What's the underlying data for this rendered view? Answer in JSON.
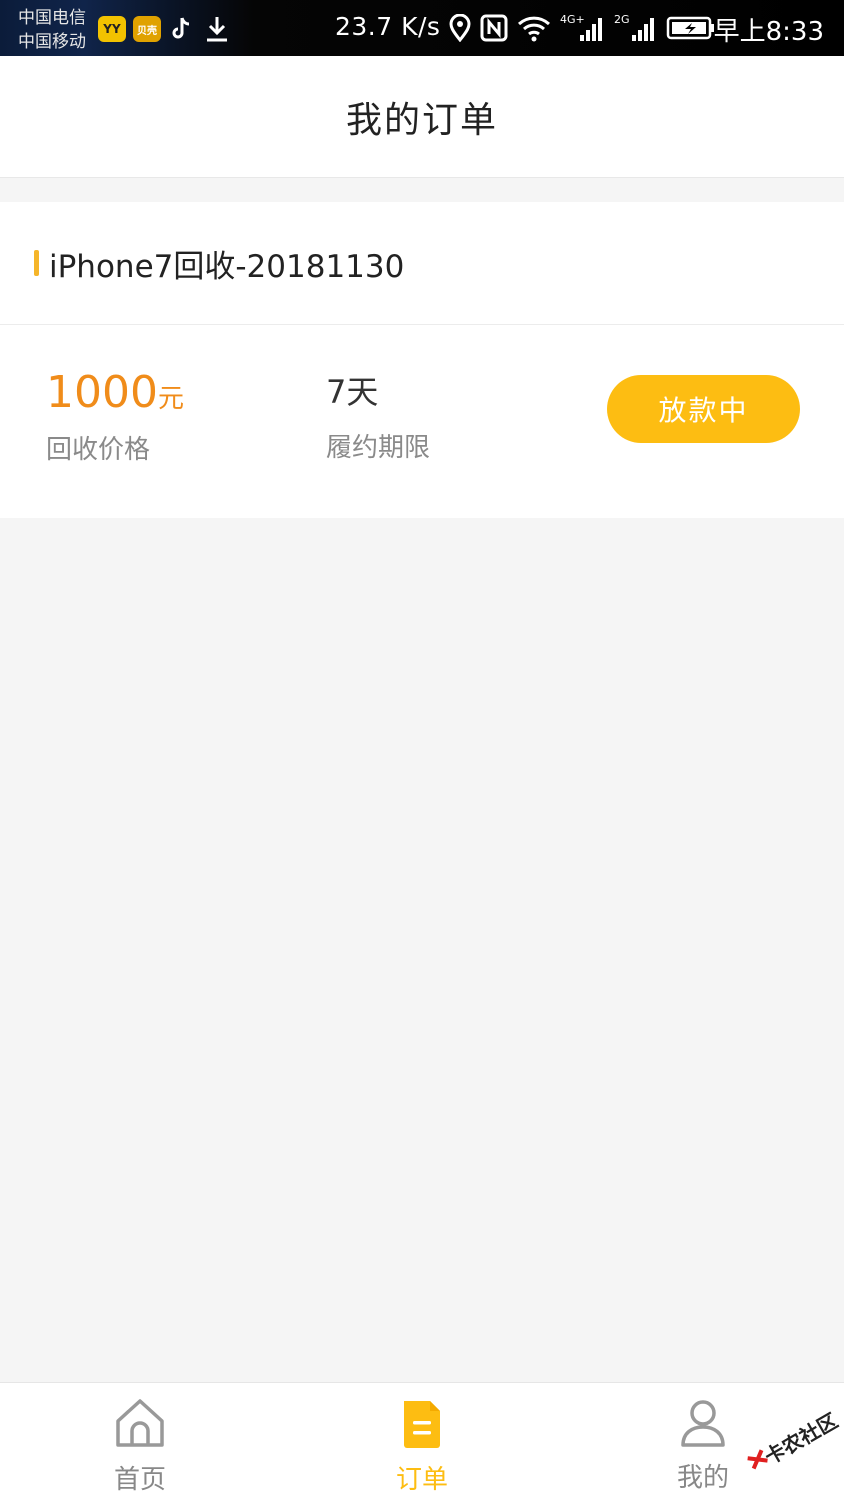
{
  "status_bar": {
    "carrier_1": "中国电信",
    "carrier_2": "中国移动",
    "app_yy": "YY",
    "app_bb": "贝壳",
    "net_speed": "23.7 K/s",
    "clock": "早上8:33",
    "icons": [
      "location-icon",
      "nfc-icon",
      "wifi-icon",
      "signal-4g-icon",
      "signal-2g-icon",
      "battery-charging-icon"
    ]
  },
  "header": {
    "title": "我的订单"
  },
  "order": {
    "title": "iPhone7回收-20181130",
    "price_value": "1000",
    "price_unit": "元",
    "price_label": "回收价格",
    "term_value": "7天",
    "term_label": "履约期限",
    "status_button": "放款中"
  },
  "nav": {
    "items": [
      {
        "label": "首页",
        "icon": "home-icon"
      },
      {
        "label": "订单",
        "icon": "document-icon",
        "active": true
      },
      {
        "label": "我的",
        "icon": "user-icon"
      }
    ]
  },
  "watermark": {
    "text": "卡农社区"
  },
  "colors": {
    "accent": "#fdbd12",
    "price": "#f08c1a",
    "accent_bar": "#f5b52a",
    "inactive_nav": "#888888"
  }
}
